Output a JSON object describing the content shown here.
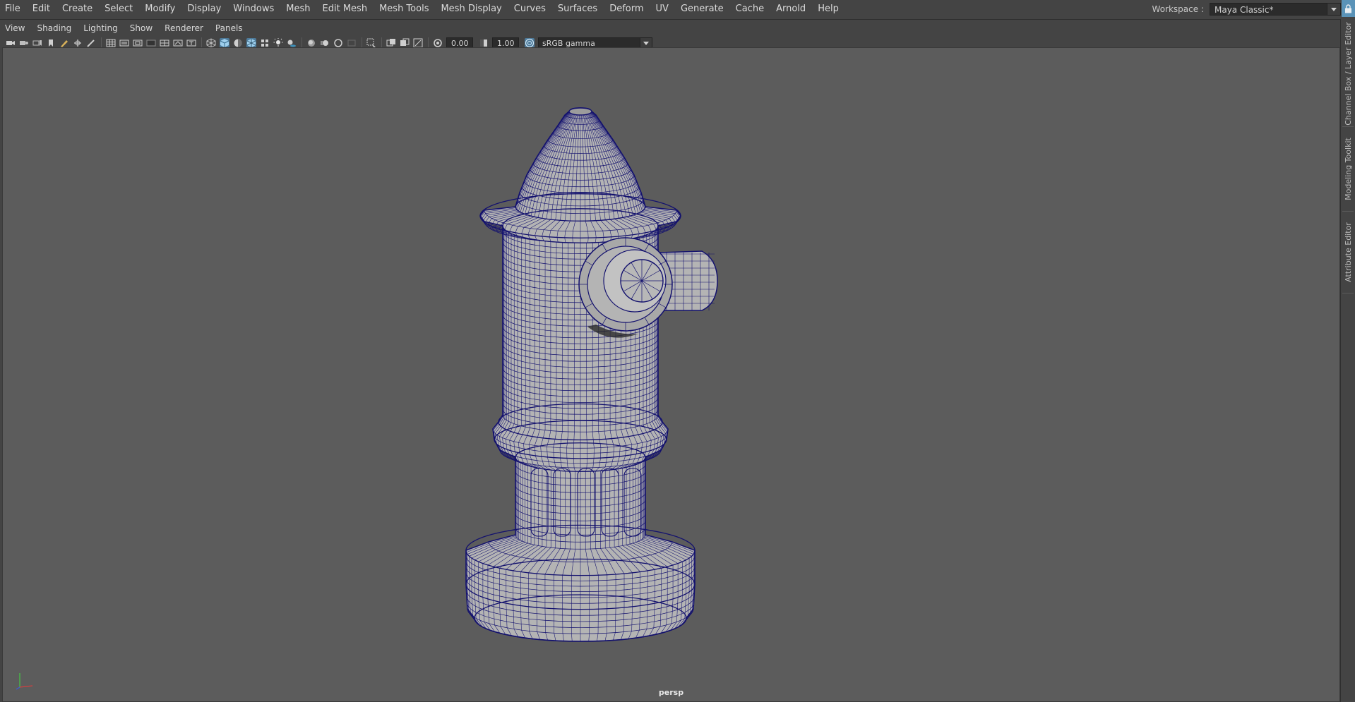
{
  "menubar": {
    "items": [
      "File",
      "Edit",
      "Create",
      "Select",
      "Modify",
      "Display",
      "Windows",
      "Mesh",
      "Edit Mesh",
      "Mesh Tools",
      "Mesh Display",
      "Curves",
      "Surfaces",
      "Deform",
      "UV",
      "Generate",
      "Cache",
      "Arnold",
      "Help"
    ]
  },
  "workspace": {
    "label": "Workspace :",
    "value": "Maya Classic*"
  },
  "panel_menu": {
    "items": [
      "View",
      "Shading",
      "Lighting",
      "Show",
      "Renderer",
      "Panels"
    ]
  },
  "panel_toolbar": {
    "exposure": "0.00",
    "gamma": "1.00",
    "color_space": "sRGB gamma"
  },
  "viewport": {
    "camera": "persp",
    "background_color": "#5c5c5c",
    "wireframe_color": "#13116e",
    "mesh_color": "#b4b4b4"
  },
  "side_tabs": [
    "Channel Box / Layer Editor",
    "Modeling Toolkit",
    "Attribute Editor"
  ],
  "colors": {
    "ui_background": "#444444",
    "accent": "#5a93b8"
  }
}
